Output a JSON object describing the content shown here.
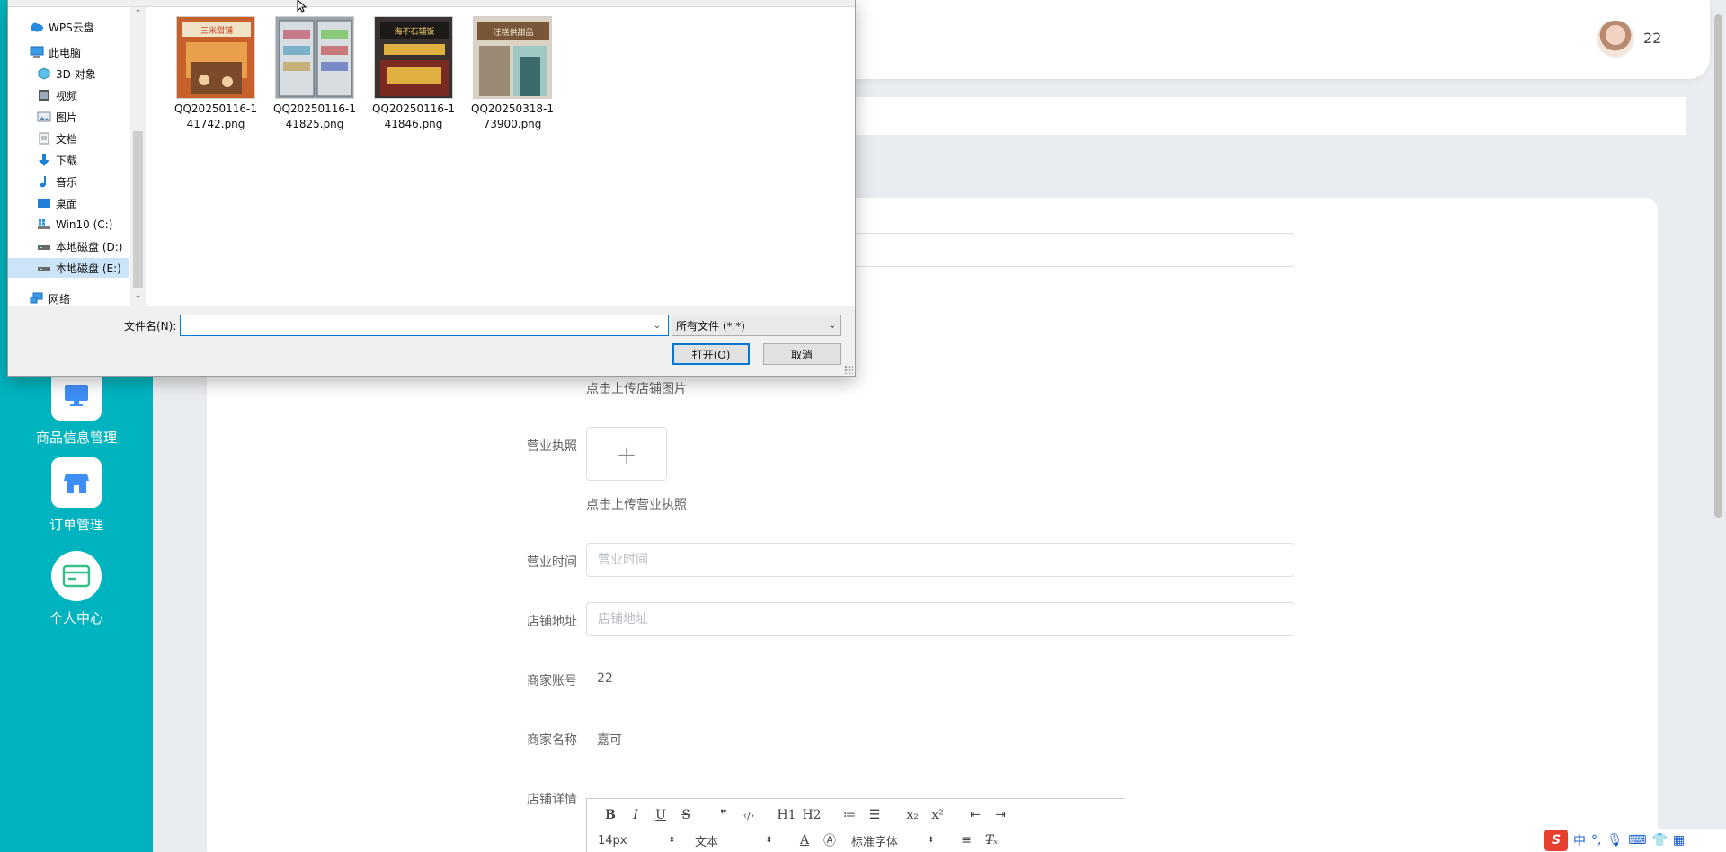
{
  "app": {
    "sidebar": {
      "items": [
        {
          "label": "商品信息管理",
          "icon": "monitor-icon"
        },
        {
          "label": "订单管理",
          "icon": "shop-icon"
        },
        {
          "label": "个人中心",
          "icon": "card-icon"
        }
      ]
    },
    "header": {
      "username": "22"
    },
    "form": {
      "store_image_hint": "点击上传店铺图片",
      "license_label": "营业执照",
      "license_hint": "点击上传营业执照",
      "hours_label": "营业时间",
      "hours_placeholder": "营业时间",
      "address_label": "店铺地址",
      "address_placeholder": "店铺地址",
      "account_label": "商家账号",
      "account_value": "22",
      "name_label": "商家名称",
      "name_value": "嘉可",
      "detail_label": "店铺详情"
    },
    "editor": {
      "font_size": "14px",
      "block_type": "文本",
      "font_family": "标准字体",
      "buttons_row1": [
        "B",
        "I",
        "U",
        "S",
        "❞",
        "‹/›",
        "H1",
        "H2",
        "≔",
        "☰",
        "x₂",
        "x²",
        "⇤",
        "⇥"
      ]
    },
    "tray": {
      "ime": "中"
    }
  },
  "dialog": {
    "tree": [
      {
        "label": "WPS云盘",
        "icon": "cloud-icon",
        "level": 1
      },
      {
        "label": "此电脑",
        "icon": "computer-icon",
        "level": 1
      },
      {
        "label": "3D 对象",
        "icon": "cube-icon",
        "level": 2
      },
      {
        "label": "视频",
        "icon": "video-icon",
        "level": 2
      },
      {
        "label": "图片",
        "icon": "picture-icon",
        "level": 2
      },
      {
        "label": "文档",
        "icon": "document-icon",
        "level": 2
      },
      {
        "label": "下载",
        "icon": "download-icon",
        "level": 2
      },
      {
        "label": "音乐",
        "icon": "music-icon",
        "level": 2
      },
      {
        "label": "桌面",
        "icon": "desktop-icon",
        "level": 2
      },
      {
        "label": "Win10 (C:)",
        "icon": "windows-drive-icon",
        "level": 2
      },
      {
        "label": "本地磁盘 (D:)",
        "icon": "drive-icon",
        "level": 2
      },
      {
        "label": "本地磁盘 (E:)",
        "icon": "drive-icon",
        "level": 2,
        "selected": true
      },
      {
        "label": "网络",
        "icon": "network-icon",
        "level": 1
      }
    ],
    "files": [
      {
        "name_line1": "QQ20250116-1",
        "name_line2": "41742.png",
        "sign": "三米甜铺",
        "colors": [
          "#c8602c",
          "#e8a04a",
          "#7a4a2a"
        ]
      },
      {
        "name_line1": "QQ20250116-1",
        "name_line2": "41825.png",
        "sign": "",
        "colors": [
          "#9aa4ae",
          "#d8dde2",
          "#5a636c"
        ]
      },
      {
        "name_line1": "QQ20250116-1",
        "name_line2": "41846.png",
        "sign": "海不石辅饭",
        "colors": [
          "#3a3230",
          "#e0b040",
          "#7a2a20"
        ]
      },
      {
        "name_line1": "QQ20250318-1",
        "name_line2": "73900.png",
        "sign": "汪糕供甜品",
        "colors": [
          "#7a5638",
          "#9ec8c4",
          "#dcd2c2"
        ]
      }
    ],
    "filename_label": "文件名(N):",
    "filename_value": "",
    "filetype": "所有文件 (*.*)",
    "open_button": "打开(O)",
    "cancel_button": "取消"
  }
}
